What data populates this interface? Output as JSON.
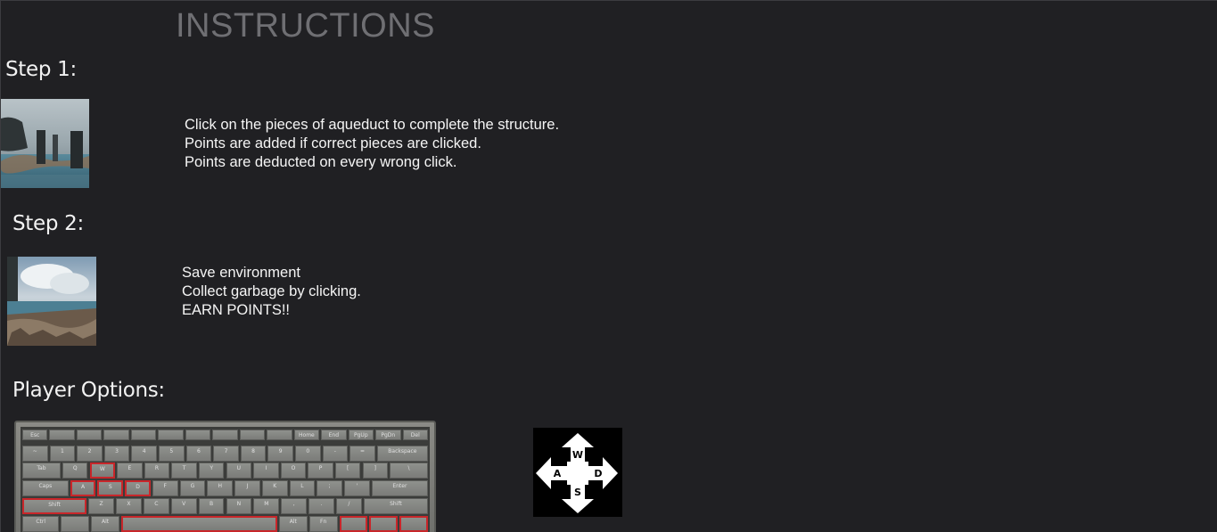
{
  "title": "INSTRUCTIONS",
  "step1": {
    "heading": "Step 1:",
    "lines": [
      "Click on the pieces of aqueduct to complete the structure.",
      "Points are added if correct pieces are clicked.",
      "Points are deducted on every wrong click."
    ]
  },
  "step2": {
    "heading": "Step 2:",
    "lines": [
      "Save environment",
      "Collect garbage by clicking.",
      "EARN POINTS!!"
    ]
  },
  "player_options": {
    "heading": "Player Options:",
    "wasd_labels": [
      "W",
      "A",
      "S",
      "D"
    ]
  },
  "keyboard": {
    "rows": [
      [
        "Esc",
        "",
        "",
        "",
        "",
        "",
        "",
        "",
        "",
        "",
        "Home",
        "End",
        "PgUp",
        "PgDn",
        "Del"
      ],
      [
        "~",
        "1",
        "2",
        "3",
        "4",
        "5",
        "6",
        "7",
        "8",
        "9",
        "0",
        "-",
        "=",
        "Backspace"
      ],
      [
        "Tab",
        "Q",
        "W",
        "E",
        "R",
        "T",
        "Y",
        "U",
        "I",
        "O",
        "P",
        "[",
        "]",
        "\\"
      ],
      [
        "Caps",
        "A",
        "S",
        "D",
        "F",
        "G",
        "H",
        "J",
        "K",
        "L",
        ";",
        "'",
        "Enter"
      ],
      [
        "Shift",
        "Z",
        "X",
        "C",
        "V",
        "B",
        "N",
        "M",
        ",",
        ".",
        "/",
        "Shift"
      ],
      [
        "Ctrl",
        "",
        "Alt",
        "",
        "Alt",
        "Fn",
        "",
        "",
        ""
      ]
    ]
  }
}
